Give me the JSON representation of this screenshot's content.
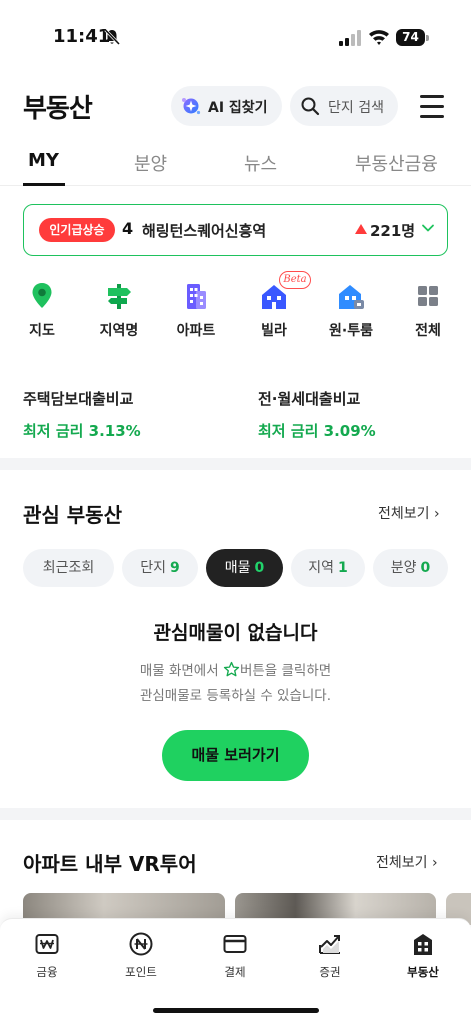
{
  "status": {
    "time": "11:41",
    "battery": "74"
  },
  "header": {
    "title": "부동산",
    "ai_button": "AI 집찾기",
    "search_placeholder": "단지 검색"
  },
  "tabs": [
    {
      "label": "MY",
      "active": true
    },
    {
      "label": "분양"
    },
    {
      "label": "뉴스"
    },
    {
      "label": "부동산금융"
    }
  ],
  "trending": {
    "badge": "인기급상승",
    "rank": "4",
    "name": "해링턴스퀘어신흥역",
    "count": "221명",
    "trend": "up"
  },
  "categories": [
    {
      "label": "지도",
      "icon": "map-pin-icon"
    },
    {
      "label": "지역명",
      "icon": "signpost-icon"
    },
    {
      "label": "아파트",
      "icon": "apartment-icon"
    },
    {
      "label": "빌라",
      "icon": "villa-icon",
      "badge": "Beta"
    },
    {
      "label": "원·투룸",
      "icon": "one-room-icon"
    },
    {
      "label": "전체",
      "icon": "grid-icon"
    }
  ],
  "loans": [
    {
      "title": "주택담보대출비교",
      "rate": "최저 금리 3.13%"
    },
    {
      "title": "전·월세대출비교",
      "rate": "최저 금리 3.09%"
    }
  ],
  "interest": {
    "title": "관심 부동산",
    "see_all": "전체보기",
    "chips": [
      {
        "label": "최근조회",
        "count": ""
      },
      {
        "label": "단지",
        "count": "9"
      },
      {
        "label": "매물",
        "count": "0",
        "active": true
      },
      {
        "label": "지역",
        "count": "1"
      },
      {
        "label": "분양",
        "count": "0"
      }
    ],
    "empty_title": "관심매물이 없습니다",
    "empty_desc_before": "매물 화면에서",
    "empty_desc_after": "버튼을 클릭하면",
    "empty_desc_line2": "관심매물로 등록하실 수 있습니다.",
    "cta": "매물 보러가기"
  },
  "vr": {
    "title": "아파트 내부 VR투어",
    "see_all": "전체보기"
  },
  "bottom_nav": [
    {
      "label": "금융",
      "icon": "won-card-icon"
    },
    {
      "label": "포인트",
      "icon": "point-coin-icon"
    },
    {
      "label": "결제",
      "icon": "card-icon"
    },
    {
      "label": "증권",
      "icon": "stock-chart-icon"
    },
    {
      "label": "부동산",
      "icon": "building-icon",
      "active": true
    }
  ],
  "colors": {
    "brand_green": "#1fd160",
    "rate_green": "#14a94f",
    "hot_red": "#ff3b3b"
  }
}
